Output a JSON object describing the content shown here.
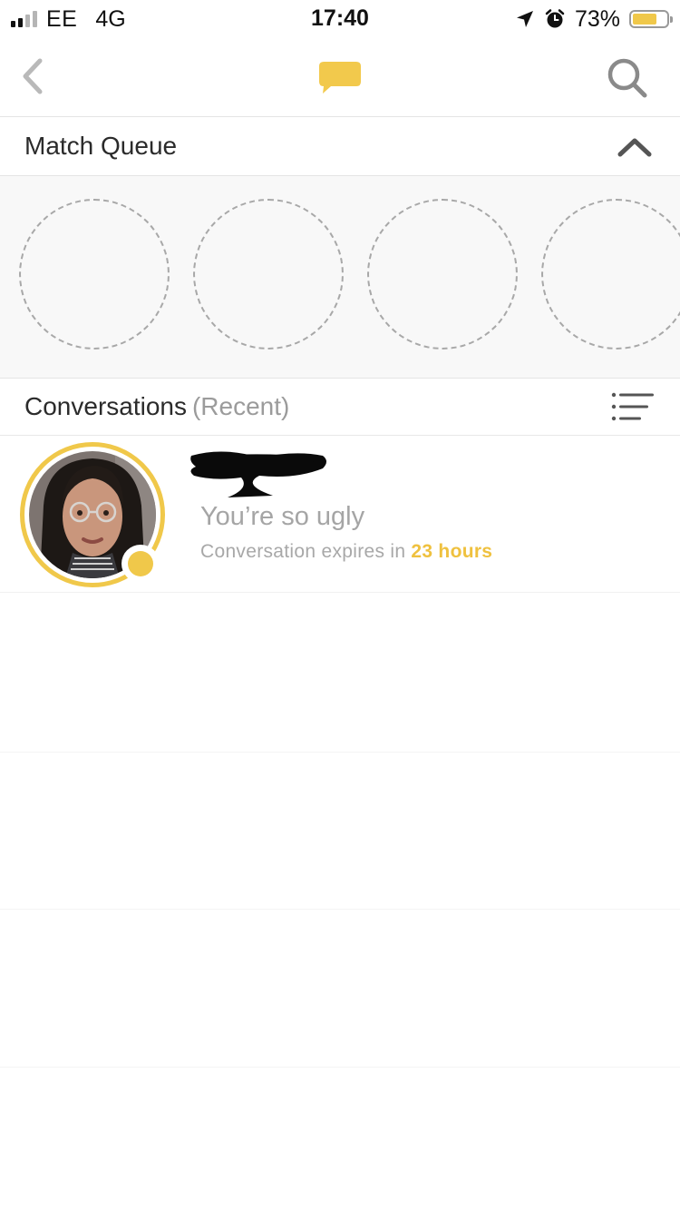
{
  "status_bar": {
    "carrier": "EE",
    "network": "4G",
    "time": "17:40",
    "battery_percent": "73%",
    "battery_level": 0.73,
    "signal_bars_active": 2,
    "signal_bars_total": 4,
    "icons": [
      "location-arrow-icon",
      "alarm-clock-icon",
      "battery-icon"
    ]
  },
  "nav": {
    "icons": [
      "back-chevron-icon",
      "chat-bubble-icon",
      "search-icon"
    ]
  },
  "match_queue": {
    "title": "Match Queue",
    "toggle_icon": "chevron-up-icon",
    "empty_slots": 4
  },
  "conversations": {
    "title": "Conversations",
    "subtitle": "(Recent)",
    "sort_icon": "filter-list-icon",
    "items": [
      {
        "name": "",
        "name_redacted": true,
        "last_message": "You’re so ugly",
        "expiry_prefix": "Conversation expires in",
        "expiry_value": "23 hours",
        "online": true
      }
    ]
  },
  "colors": {
    "accent": "#f0c84a",
    "accent_text": "#efc13f",
    "divider": "#e4e4e4",
    "queue_bg": "#f8f8f8",
    "muted_text": "#a5a5a5",
    "icon_grey": "#8a8a8a"
  }
}
